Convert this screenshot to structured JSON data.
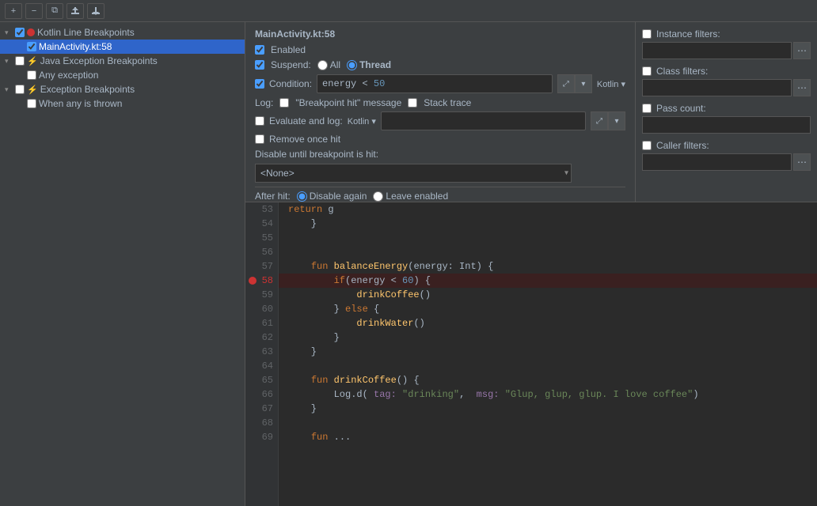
{
  "toolbar": {
    "add_label": "+",
    "remove_label": "−",
    "copy_label": "⧉",
    "export_label": "↑",
    "import_label": "↓"
  },
  "breakpoint_title": "MainActivity.kt:58",
  "tree": {
    "groups": [
      {
        "id": "kotlin-line",
        "label": "Kotlin Line Breakpoints",
        "expanded": true,
        "children": [
          {
            "id": "mainactivity",
            "label": "MainActivity.kt:58",
            "selected": true
          }
        ]
      },
      {
        "id": "java-exception",
        "label": "Java Exception Breakpoints",
        "expanded": true,
        "children": [
          {
            "id": "any-exception",
            "label": "Any exception"
          }
        ]
      },
      {
        "id": "exception-bp",
        "label": "Exception Breakpoints",
        "expanded": true,
        "children": [
          {
            "id": "when-any-thrown",
            "label": "When any is thrown"
          }
        ]
      }
    ]
  },
  "config": {
    "enabled_label": "Enabled",
    "suspend_label": "Suspend:",
    "all_label": "All",
    "thread_label": "Thread",
    "condition_label": "Condition:",
    "condition_value": "energy < 50",
    "kotlin_label": "Kotlin ▾",
    "log_label": "Log:",
    "breakpoint_hit_label": "\"Breakpoint hit\" message",
    "stack_trace_label": "Stack trace",
    "instance_filters_label": "Instance filters:",
    "evaluate_label": "Evaluate and log:",
    "evaluate_kotlin_label": "Kotlin ▾",
    "class_filters_label": "Class filters:",
    "remove_once_hit_label": "Remove once hit",
    "pass_count_label": "Pass count:",
    "disable_until_label": "Disable until breakpoint is hit:",
    "disable_select_value": "<None>",
    "disable_options": [
      "<None>"
    ],
    "caller_filters_label": "Caller filters:",
    "after_hit_label": "After hit:",
    "disable_again_label": "Disable again",
    "leave_enabled_label": "Leave enabled"
  },
  "code": {
    "lines": [
      {
        "num": "53",
        "content": "    return g",
        "highlight": false,
        "is_return": true
      },
      {
        "num": "54",
        "content": "    }",
        "highlight": false
      },
      {
        "num": "55",
        "content": "",
        "highlight": false
      },
      {
        "num": "56",
        "content": "",
        "highlight": false
      },
      {
        "num": "57",
        "content": "    fun balanceEnergy(energy: Int) {",
        "highlight": false
      },
      {
        "num": "58",
        "content": "        if(energy < 60) {",
        "highlight": true,
        "breakpoint": true
      },
      {
        "num": "59",
        "content": "            drinkCoffee()",
        "highlight": false
      },
      {
        "num": "60",
        "content": "        } else {",
        "highlight": false
      },
      {
        "num": "61",
        "content": "            drinkWater()",
        "highlight": false
      },
      {
        "num": "62",
        "content": "        }",
        "highlight": false
      },
      {
        "num": "63",
        "content": "    }",
        "highlight": false
      },
      {
        "num": "64",
        "content": "",
        "highlight": false
      },
      {
        "num": "65",
        "content": "    fun drinkCoffee() {",
        "highlight": false
      },
      {
        "num": "66",
        "content": "        Log.d( tag: \"drinking\",  msg: \"Glup, glup, glup. I love coffee\")",
        "highlight": false
      },
      {
        "num": "67",
        "content": "    }",
        "highlight": false
      },
      {
        "num": "68",
        "content": "",
        "highlight": false
      },
      {
        "num": "69",
        "content": "    fun ...",
        "highlight": false
      }
    ]
  }
}
